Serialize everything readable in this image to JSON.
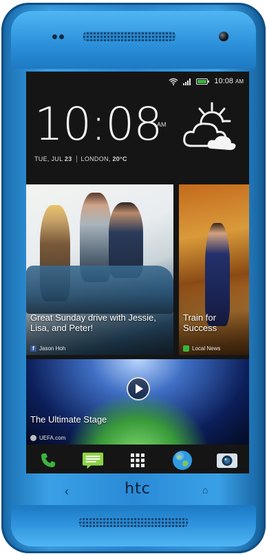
{
  "device": {
    "brand": "htc"
  },
  "status_bar": {
    "time": "10:08",
    "ampm": "AM"
  },
  "clock_widget": {
    "time": "10:08",
    "ampm": "AM",
    "day": "TUE, JUL",
    "day_num": "23",
    "location": "LONDON,",
    "temperature": "20°C",
    "weather_icon": "partly-cloudy-icon"
  },
  "feed": {
    "tile1": {
      "caption": "Great Sunday drive with Jessie, Lisa, and Peter!",
      "source": "Jason Hoh",
      "source_icon": "facebook-icon"
    },
    "tile2": {
      "caption": "Train for Success",
      "source": "Local News",
      "source_icon": "news-icon"
    },
    "tile3": {
      "caption": "The Ultimate Stage",
      "source": "UEFA.com",
      "source_icon": "person-icon"
    }
  },
  "dock": [
    {
      "icon": "phone-icon"
    },
    {
      "icon": "messages-icon"
    },
    {
      "icon": "apps-grid-icon"
    },
    {
      "icon": "browser-globe-icon"
    },
    {
      "icon": "camera-icon"
    }
  ],
  "colors": {
    "body": "#2a8ad6",
    "screen": "#151515",
    "accent_green": "#3db43d"
  }
}
